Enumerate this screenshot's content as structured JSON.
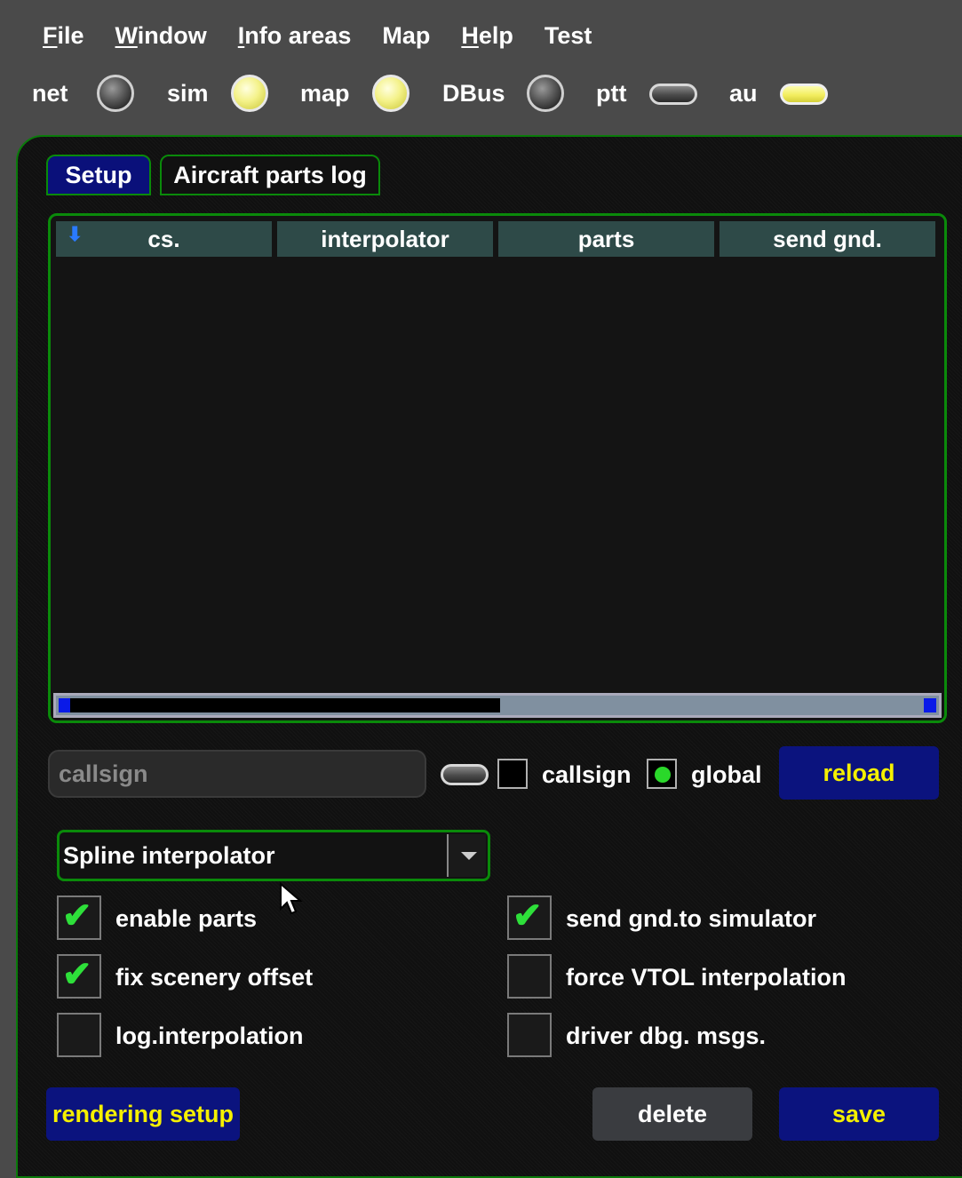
{
  "menu": [
    {
      "accel": "F",
      "rest": "ile"
    },
    {
      "accel": "W",
      "rest": "indow"
    },
    {
      "accel": "I",
      "rest": "nfo areas"
    },
    {
      "accel": "",
      "rest": "Map"
    },
    {
      "accel": "H",
      "rest": "elp"
    },
    {
      "accel": "",
      "rest": "Test"
    }
  ],
  "indicators": {
    "net": {
      "label": "net",
      "state": "off"
    },
    "sim": {
      "label": "sim",
      "state": "on"
    },
    "map": {
      "label": "map",
      "state": "on"
    },
    "dbus": {
      "label": "DBus",
      "state": "off"
    },
    "ptt": {
      "label": "ptt",
      "state": "off"
    },
    "au": {
      "label": "au",
      "state": "on"
    }
  },
  "tabs": {
    "setup": "Setup",
    "parts_log": "Aircraft parts log"
  },
  "table": {
    "columns": [
      "cs.",
      "interpolator",
      "parts",
      "send gnd."
    ],
    "rows": [],
    "scroll_position": 0.5
  },
  "filter": {
    "callsign_placeholder": "callsign",
    "callsign_checkbox_label": "callsign",
    "callsign_checked": false,
    "global_label": "global",
    "global_selected": true,
    "reload_label": "reload"
  },
  "interpolator_select": {
    "value": "Spline interpolator"
  },
  "options": {
    "enable_parts": {
      "label": "enable parts",
      "checked": true
    },
    "send_gnd": {
      "label": "send gnd.to simulator",
      "checked": true
    },
    "fix_scenery": {
      "label": "fix scenery offset",
      "checked": true
    },
    "force_vtol": {
      "label": "force VTOL interpolation",
      "checked": false
    },
    "log_interp": {
      "label": "log.interpolation",
      "checked": false
    },
    "driver_dbg": {
      "label": "driver dbg. msgs.",
      "checked": false
    }
  },
  "buttons": {
    "rendering_setup": "rendering setup",
    "delete": "delete",
    "save": "save"
  },
  "colors": {
    "accent_green": "#0a8a0a",
    "button_blue": "#0b137e",
    "button_text_yellow": "#f5f000",
    "led_on": "#f4f28a"
  }
}
